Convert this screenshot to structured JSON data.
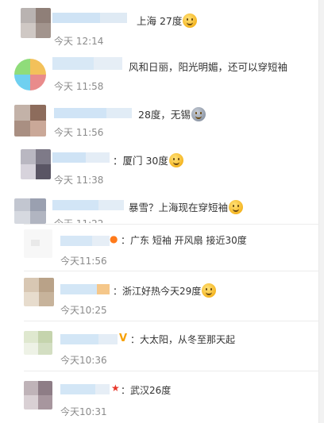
{
  "comments": [
    {
      "text": "上海 27度",
      "time": "今天 12:14",
      "emoji": "smile-emoji"
    },
    {
      "text": "风和日丽，阳光明媚，还可以穿短袖",
      "time": "今天 11:58"
    },
    {
      "text": "28度，无锡",
      "time": "今天 11:56",
      "emoji": "crying-emoji"
    },
    {
      "text": "：厦门  30度",
      "time": "今天 11:38",
      "emoji": "smile-emoji"
    },
    {
      "text": "暴雪？上海现在穿短袖",
      "time": "今天 11:22",
      "emoji": "laugh-cry-emoji"
    }
  ],
  "replies": [
    {
      "text": "：广东 短袖 开风扇 接近30度",
      "time": "今天11:56"
    },
    {
      "text": "：浙江好热今天29度",
      "time": "今天10:25",
      "emoji": "laugh-emoji"
    },
    {
      "text": "：大太阳，从冬至那天起",
      "time": "今天10:36",
      "badge": "V"
    },
    {
      "text": "：武汉26度",
      "time": "今天10:31",
      "badge": "★"
    }
  ],
  "colors": {
    "badge_v": "#f7a000",
    "badge_star": "#e8372a"
  }
}
